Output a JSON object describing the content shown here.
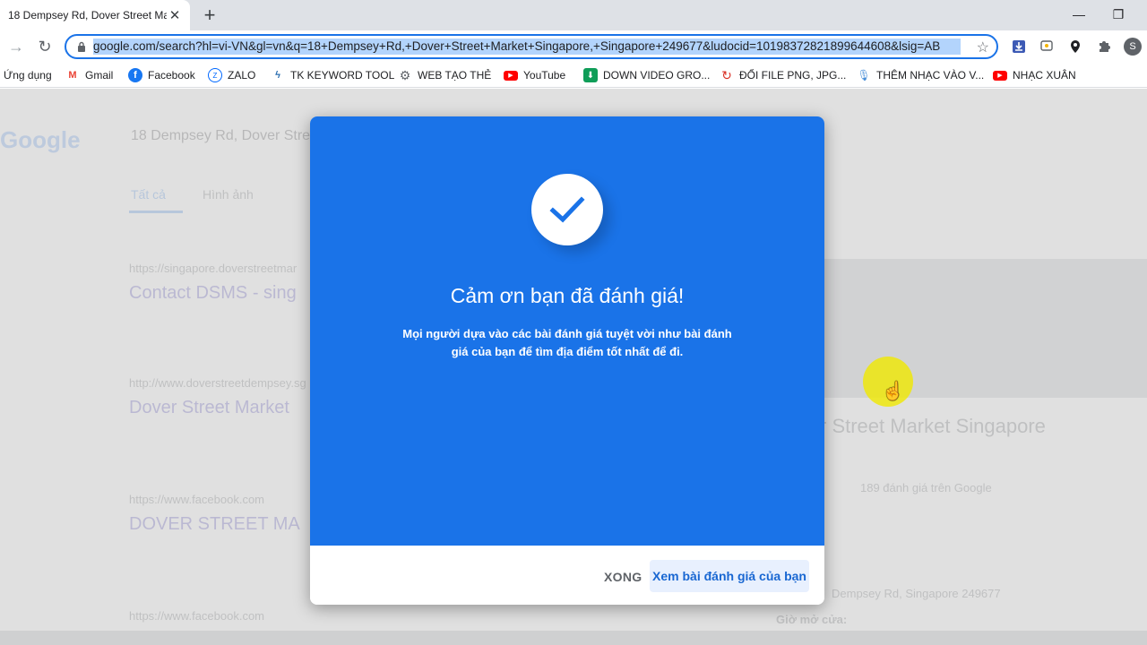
{
  "browser": {
    "tab_title": "18 Dempsey Rd, Dover Street Ma",
    "tab_close": "✕",
    "new_tab": "+",
    "url": "google.com/search?hl=vi-VN&gl=vn&q=18+Dempsey+Rd,+Dover+Street+Market+Singapore,+Singapore+249677&ludocid=10198372821899644608&lsig=AB",
    "window_min": "—",
    "window_restore": "❐",
    "profile_initial": "S",
    "accent_color": "#1a73e8"
  },
  "bookmarks": [
    {
      "label": "Ứng dụng",
      "icon": "apps-grid-icon"
    },
    {
      "label": "Gmail",
      "icon": "gmail-icon"
    },
    {
      "label": "Facebook",
      "icon": "facebook-icon"
    },
    {
      "label": "ZALO",
      "icon": "zalo-icon"
    },
    {
      "label": "TK KEYWORD TOOL",
      "icon": "keyword-tool-icon"
    },
    {
      "label": "WEB TẠO THẺ",
      "icon": "gear-icon"
    },
    {
      "label": "YouTube",
      "icon": "youtube-icon"
    },
    {
      "label": "DOWN VIDEO GRO...",
      "icon": "download-icon"
    },
    {
      "label": "ĐỔI FILE PNG, JPG...",
      "icon": "convert-icon"
    },
    {
      "label": "THÊM NHẠC VÀO V...",
      "icon": "microphone-icon"
    },
    {
      "label": "NHẠC XUÂN",
      "icon": "youtube-icon"
    }
  ],
  "background": {
    "search_query": "18 Dempsey Rd, Dover Stre",
    "tab_all": "Tất cả",
    "tab_images": "Hình ảnh",
    "result1_url": "https://singapore.doverstreetmar",
    "result1_title": "Contact DSMS - sing",
    "result2_url": "http://www.doverstreetdempsey.sg",
    "result2_title": "Dover Street Market",
    "result3_url": "https://www.facebook.com",
    "result3_title": "DOVER STREET MA",
    "result4_url": "https://www.facebook.com",
    "place_title": "r Street Market Singapore",
    "reviews": "189 đánh giá trên Google",
    "address": "Dempsey Rd, Singapore 249677",
    "hours": "Giờ mở cửa:"
  },
  "dialog": {
    "title": "Cảm ơn bạn đã đánh giá!",
    "message": "Mọi người dựa vào các bài đánh giá tuyệt vời như bài đánh giá của bạn để tìm địa điểm tốt nhất để đi.",
    "done_label": "XONG",
    "view_label": "Xem bài đánh giá của bạn",
    "header_color": "#1a73e8"
  }
}
